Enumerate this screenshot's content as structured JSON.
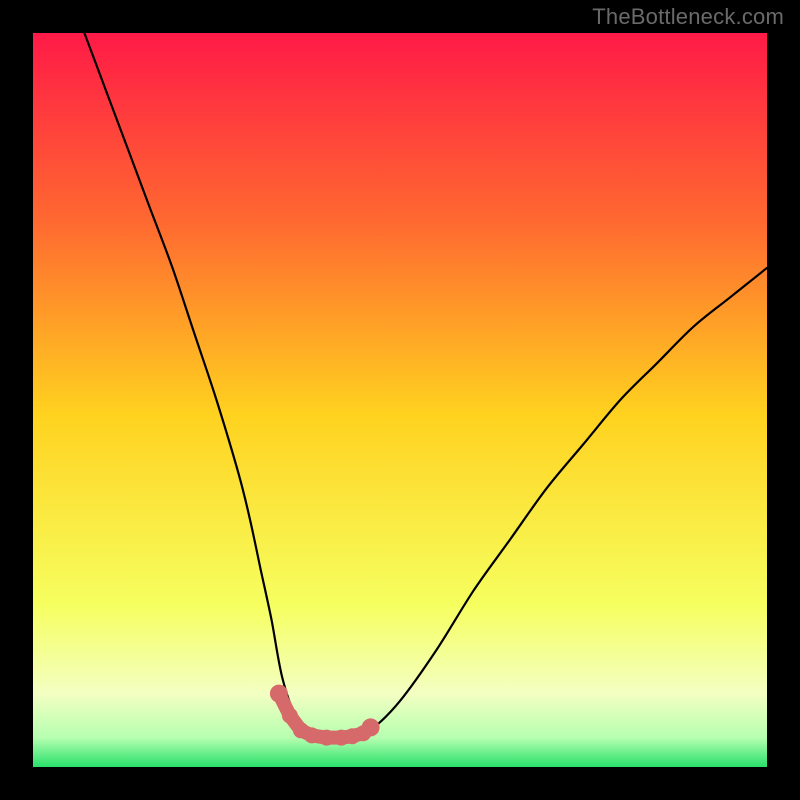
{
  "attribution": "TheBottleneck.com",
  "colors": {
    "frame": "#000000",
    "gradient_top": "#ff1a47",
    "gradient_mid_upper": "#ff7a2e",
    "gradient_mid": "#ffd21f",
    "gradient_lower": "#f6ff60",
    "gradient_pale": "#f3ffc2",
    "gradient_green": "#29e06b",
    "curve": "#000000",
    "highlight": "#d66a6a"
  },
  "chart_data": {
    "type": "line",
    "title": "",
    "xlabel": "",
    "ylabel": "",
    "xlim": [
      0,
      100
    ],
    "ylim": [
      0,
      100
    ],
    "grid": false,
    "series": [
      {
        "name": "bottleneck-curve",
        "x": [
          7,
          10,
          13,
          16,
          19,
          22,
          25,
          28,
          29.5,
          31,
          32.5,
          34,
          36,
          38,
          40,
          42,
          44,
          46,
          50,
          55,
          60,
          65,
          70,
          75,
          80,
          85,
          90,
          95,
          100
        ],
        "y": [
          100,
          92,
          84,
          76,
          68,
          59,
          50,
          40,
          34,
          27,
          20,
          12,
          6.5,
          4.5,
          4,
          4,
          4.2,
          5,
          9,
          16,
          24,
          31,
          38,
          44,
          50,
          55,
          60,
          64,
          68
        ]
      }
    ],
    "annotations": [
      {
        "name": "valley-highlight",
        "type": "points",
        "x": [
          33.5,
          35,
          36.5,
          38,
          40,
          42,
          43.5,
          45,
          46
        ],
        "y": [
          10,
          7,
          5,
          4.3,
          4,
          4,
          4.2,
          4.6,
          5.4
        ]
      }
    ]
  }
}
